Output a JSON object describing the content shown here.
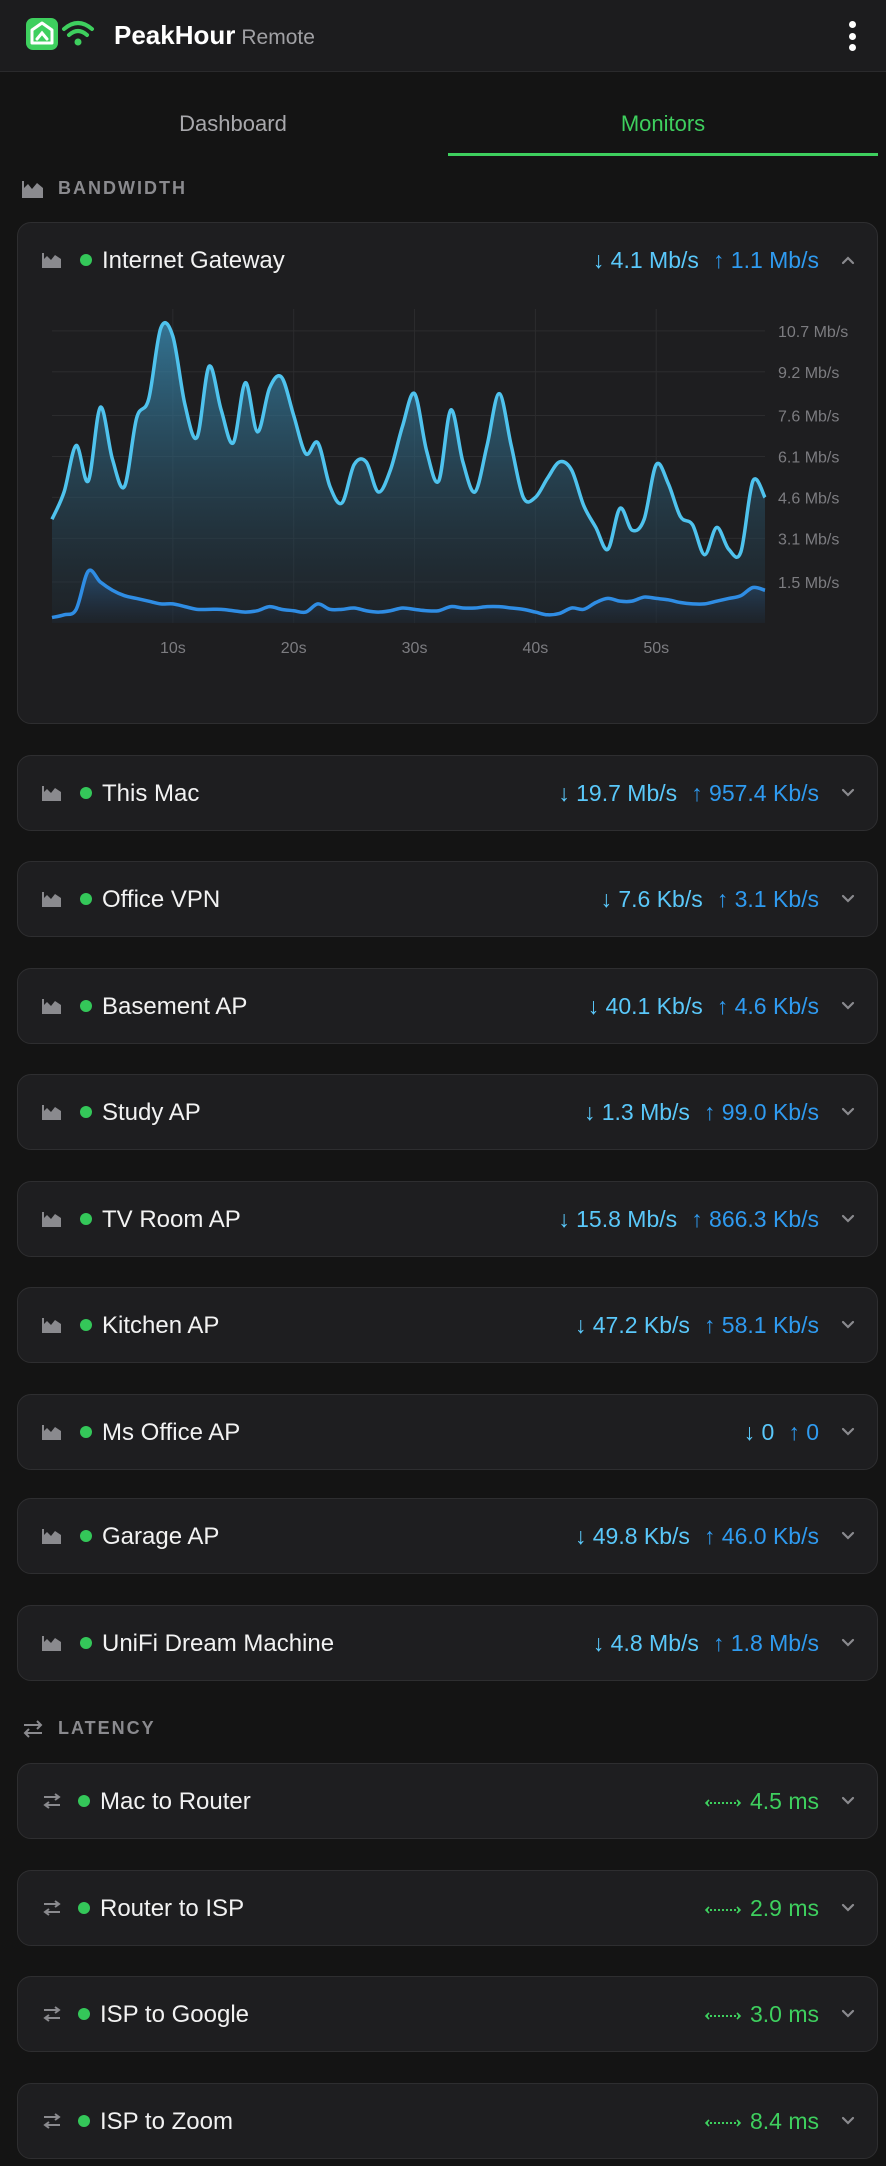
{
  "app": {
    "name": "PeakHour",
    "subtitle": "Remote"
  },
  "tabs": [
    {
      "label": "Dashboard",
      "active": false
    },
    {
      "label": "Monitors",
      "active": true
    }
  ],
  "colors": {
    "accent": "#3ecf5e",
    "download": "#5ac8fa",
    "upload": "#2f9bf0",
    "status_ok": "#34c759"
  },
  "sections": {
    "bandwidth": {
      "label": "BANDWIDTH",
      "icon": "area-chart-icon"
    },
    "latency": {
      "label": "LATENCY",
      "icon": "arrows-exchange-icon"
    }
  },
  "bandwidth_monitors": [
    {
      "name": "Internet Gateway",
      "down": "↓ 4.1 Mb/s",
      "up": "↑ 1.1 Mb/s",
      "expanded": true
    },
    {
      "name": "This Mac",
      "down": "↓ 19.7 Mb/s",
      "up": "↑ 957.4 Kb/s"
    },
    {
      "name": "Office VPN",
      "down": "↓ 7.6 Kb/s",
      "up": "↑ 3.1 Kb/s"
    },
    {
      "name": "Basement AP",
      "down": "↓ 40.1 Kb/s",
      "up": "↑ 4.6 Kb/s"
    },
    {
      "name": "Study AP",
      "down": "↓ 1.3 Mb/s",
      "up": "↑ 99.0 Kb/s"
    },
    {
      "name": "TV Room AP",
      "down": "↓ 15.8 Mb/s",
      "up": "↑ 866.3 Kb/s"
    },
    {
      "name": "Kitchen AP",
      "down": "↓ 47.2 Kb/s",
      "up": "↑ 58.1 Kb/s"
    },
    {
      "name": "Ms Office AP",
      "down": "↓ 0",
      "up": "↑ 0"
    },
    {
      "name": "Garage AP",
      "down": "↓ 49.8 Kb/s",
      "up": "↑ 46.0 Kb/s"
    },
    {
      "name": "UniFi Dream Machine",
      "down": "↓ 4.8 Mb/s",
      "up": "↑ 1.8 Mb/s"
    }
  ],
  "latency_monitors": [
    {
      "name": "Mac to Router",
      "value": "4.5 ms"
    },
    {
      "name": "Router to ISP",
      "value": "2.9 ms"
    },
    {
      "name": "ISP to Google",
      "value": "3.0 ms"
    },
    {
      "name": "ISP to Zoom",
      "value": "8.4 ms"
    }
  ],
  "chart_data": {
    "type": "area",
    "x_tick_labels": [
      "10s",
      "20s",
      "30s",
      "40s",
      "50s"
    ],
    "x_ticks": [
      10,
      20,
      30,
      40,
      50
    ],
    "xlim": [
      0,
      59
    ],
    "y_tick_labels": [
      "10.7 Mb/s",
      "9.2 Mb/s",
      "7.6 Mb/s",
      "6.1 Mb/s",
      "4.6 Mb/s",
      "3.1 Mb/s",
      "1.5 Mb/s"
    ],
    "y_ticks": [
      10.7,
      9.2,
      7.6,
      6.1,
      4.6,
      3.1,
      1.5
    ],
    "ylim": [
      0,
      11.5
    ],
    "grid": true,
    "x": [
      0,
      1,
      2,
      3,
      4,
      5,
      6,
      7,
      8,
      9,
      10,
      11,
      12,
      13,
      14,
      15,
      16,
      17,
      18,
      19,
      20,
      21,
      22,
      23,
      24,
      25,
      26,
      27,
      28,
      29,
      30,
      31,
      32,
      33,
      34,
      35,
      36,
      37,
      38,
      39,
      40,
      41,
      42,
      43,
      44,
      45,
      46,
      47,
      48,
      49,
      50,
      51,
      52,
      53,
      54,
      55,
      56,
      57,
      58,
      59
    ],
    "series": [
      {
        "role": "download",
        "values": [
          3.8,
          4.8,
          6.5,
          5.2,
          7.9,
          6.0,
          5.0,
          7.5,
          8.2,
          10.8,
          10.5,
          8.0,
          6.8,
          9.4,
          7.8,
          6.6,
          8.8,
          7.0,
          8.6,
          9.0,
          7.6,
          6.2,
          6.6,
          5.0,
          4.4,
          5.8,
          5.9,
          4.8,
          5.6,
          7.2,
          8.4,
          6.3,
          5.2,
          7.8,
          5.9,
          4.8,
          6.5,
          8.4,
          6.5,
          4.6,
          4.6,
          5.3,
          5.9,
          5.6,
          4.3,
          3.5,
          2.7,
          4.2,
          3.4,
          3.8,
          5.8,
          5.1,
          3.9,
          3.6,
          2.5,
          3.5,
          2.7,
          2.6,
          5.2,
          4.6
        ]
      },
      {
        "role": "upload",
        "values": [
          0.2,
          0.3,
          0.5,
          1.9,
          1.5,
          1.2,
          1.0,
          0.9,
          0.8,
          0.7,
          0.7,
          0.6,
          0.5,
          0.5,
          0.5,
          0.45,
          0.4,
          0.45,
          0.6,
          0.5,
          0.45,
          0.4,
          0.7,
          0.5,
          0.5,
          0.55,
          0.45,
          0.4,
          0.45,
          0.55,
          0.5,
          0.45,
          0.45,
          0.6,
          0.55,
          0.55,
          0.6,
          0.6,
          0.55,
          0.5,
          0.4,
          0.3,
          0.35,
          0.55,
          0.5,
          0.75,
          0.9,
          0.8,
          0.8,
          0.95,
          0.9,
          0.85,
          0.75,
          0.7,
          0.7,
          0.8,
          0.9,
          1.0,
          1.3,
          1.2
        ]
      }
    ]
  }
}
